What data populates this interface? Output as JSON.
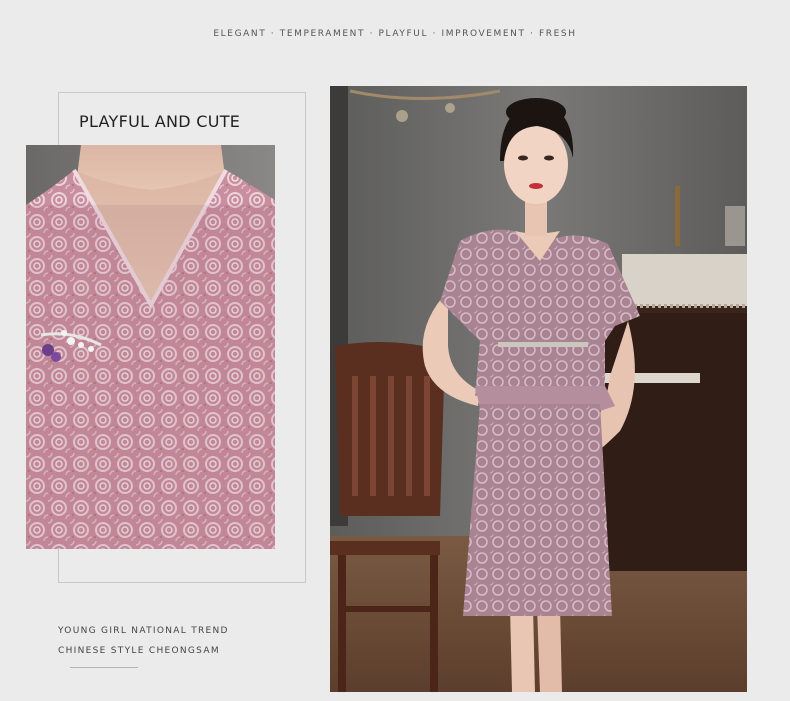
{
  "tagline": "ELEGANT · TEMPERAMENT · PLAYFUL · IMPROVEMENT · FRESH",
  "section_heading": "PLAYFUL AND CUTE",
  "captions": {
    "line1": "YOUNG GIRL NATIONAL TREND",
    "line2": "CHINESE STYLE CHEONGSAM"
  },
  "colors": {
    "background": "#ebebeb",
    "dress_pink": "#c98ea0",
    "lace_light": "#e9cfd8",
    "wall_gray": "#6f6e6c",
    "wood_brown": "#5a2f1f",
    "floor_brown": "#6b4a35"
  }
}
